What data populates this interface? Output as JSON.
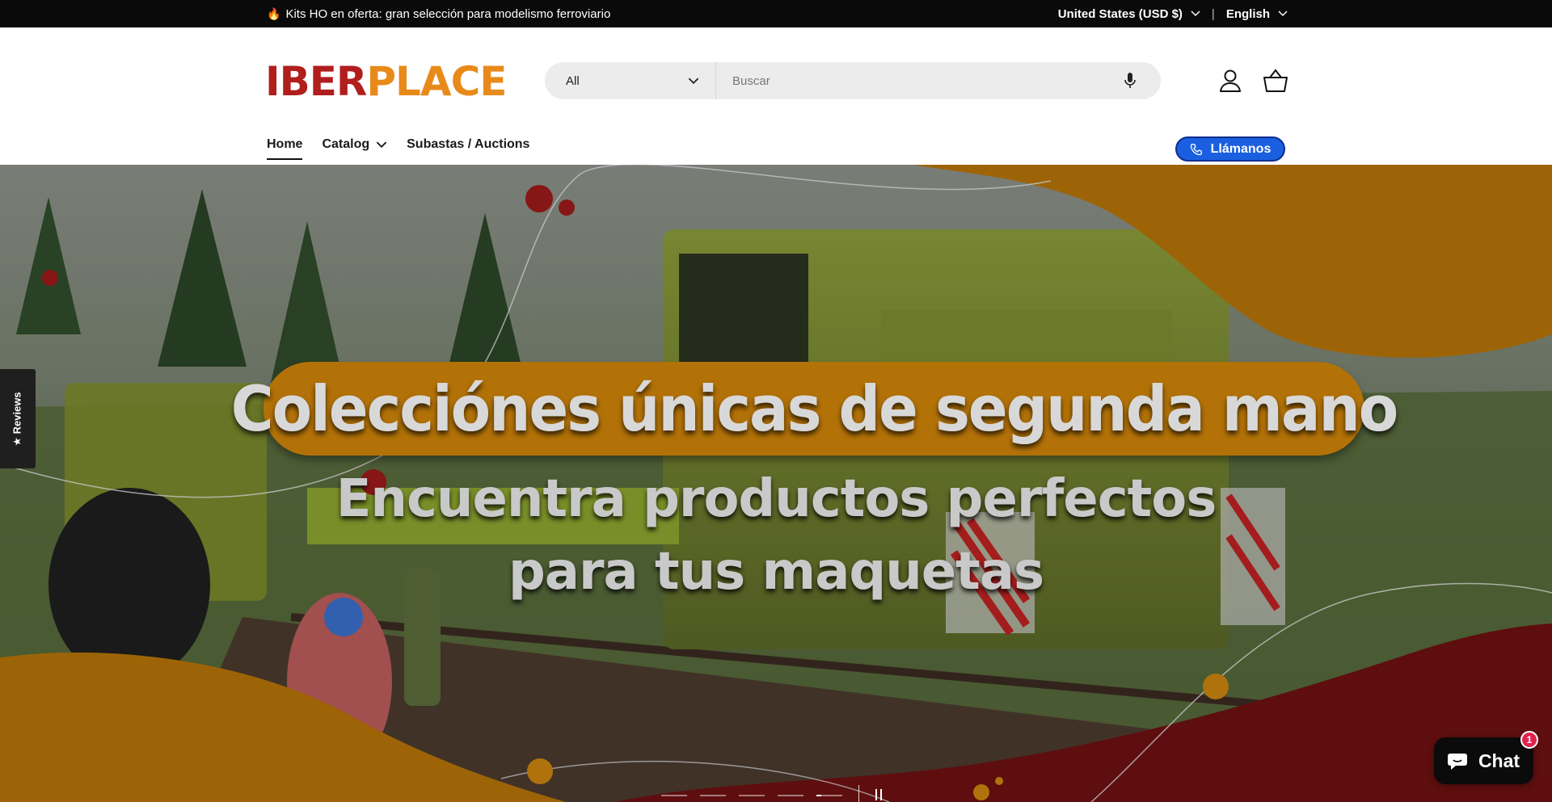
{
  "announcement": {
    "fire_icon": "fire-emoji",
    "message": "Kits HO en oferta: gran selección para modelismo ferroviario",
    "currency": "United States (USD $)",
    "language": "English"
  },
  "header": {
    "logo": {
      "part1": "IBER",
      "part2": "PLACE",
      "colors": {
        "primary": "#b01e1e",
        "secondary": "#e88a1a"
      }
    },
    "search": {
      "category": "All",
      "placeholder": "Buscar"
    },
    "icons": [
      "account-icon",
      "cart-icon",
      "microphone-icon"
    ]
  },
  "nav": {
    "items": [
      {
        "label": "Home",
        "active": true
      },
      {
        "label": "Catalog",
        "has_dropdown": true
      },
      {
        "label": "Subastas / Auctions"
      }
    ],
    "call_button": "Llámanos"
  },
  "hero": {
    "headline": "Colecciónes únicas de segunda mano",
    "subline1": "Encuentra productos perfectos",
    "subline2": "para tus maquetas",
    "colors": {
      "orange": "#b37208",
      "maroon": "#6b1010",
      "red_dot": "#9a1a1a"
    },
    "slide_count": 5,
    "active_slide": 5
  },
  "reviews_tab": "★ Reviews",
  "chat": {
    "label": "Chat",
    "badge": "1"
  }
}
